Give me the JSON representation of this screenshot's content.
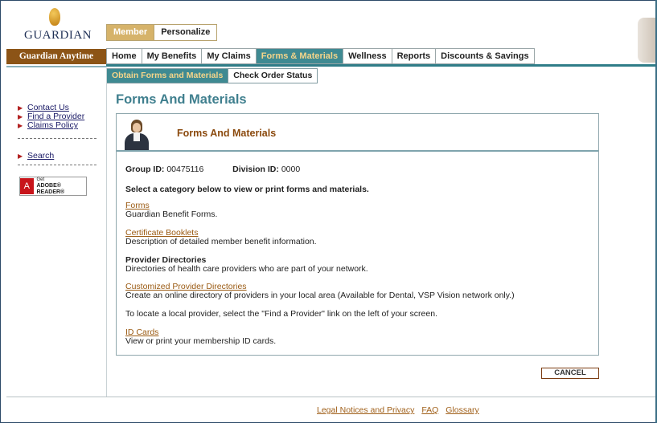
{
  "header": {
    "logo_text": "GUARDIAN",
    "brand_bar": "Guardian Anytime",
    "top_tabs": [
      {
        "label": "Member"
      },
      {
        "label": "Personalize"
      }
    ]
  },
  "nav": {
    "items": [
      {
        "label": "Home"
      },
      {
        "label": "My Benefits"
      },
      {
        "label": "My Claims"
      },
      {
        "label": "Forms & Materials"
      },
      {
        "label": "Wellness"
      },
      {
        "label": "Reports"
      },
      {
        "label": "Discounts & Savings"
      }
    ],
    "active": "Forms & Materials"
  },
  "subnav": {
    "items": [
      {
        "label": "Obtain Forms and Materials"
      },
      {
        "label": "Check Order Status"
      }
    ]
  },
  "sidebar": {
    "links": [
      {
        "label": "Contact Us"
      },
      {
        "label": "Find a Provider"
      },
      {
        "label": "Claims Policy"
      }
    ],
    "search_label": "Search",
    "adobe": {
      "line1": "Get",
      "line2": "ADOBE® READER®",
      "logo": "A"
    }
  },
  "main": {
    "page_title": "Forms And Materials",
    "panel_title": "Forms And Materials",
    "group_id_label": "Group ID:",
    "group_id_value": "00475116",
    "division_id_label": "Division ID:",
    "division_id_value": "0000",
    "intro": "Select a category below to view or print forms and materials.",
    "items": [
      {
        "title": "Forms",
        "desc": "Guardian Benefit Forms."
      },
      {
        "title": "Certificate Booklets",
        "desc": "Description of detailed member benefit information."
      },
      {
        "title": "Provider Directories",
        "desc": "Directories of health care providers who are part of your network."
      },
      {
        "title": "Customized Provider Directories",
        "desc": "Create an online directory of providers in your local area (Available for Dental, VSP Vision network only.)"
      },
      {
        "title": "",
        "desc": "To locate a local provider, select the \"Find a Provider\" link on the left of your screen."
      },
      {
        "title": "ID Cards",
        "desc": "View or print your membership ID cards."
      }
    ],
    "cancel_label": "CANCEL"
  },
  "footer": {
    "links": [
      {
        "label": "Legal Notices and Privacy"
      },
      {
        "label": "FAQ"
      },
      {
        "label": "Glossary"
      }
    ]
  },
  "colors": {
    "teal": "#3f8a92",
    "brand_brown": "#8c5416",
    "gold": "#d6b36a",
    "link_orange": "#9a5a12"
  }
}
